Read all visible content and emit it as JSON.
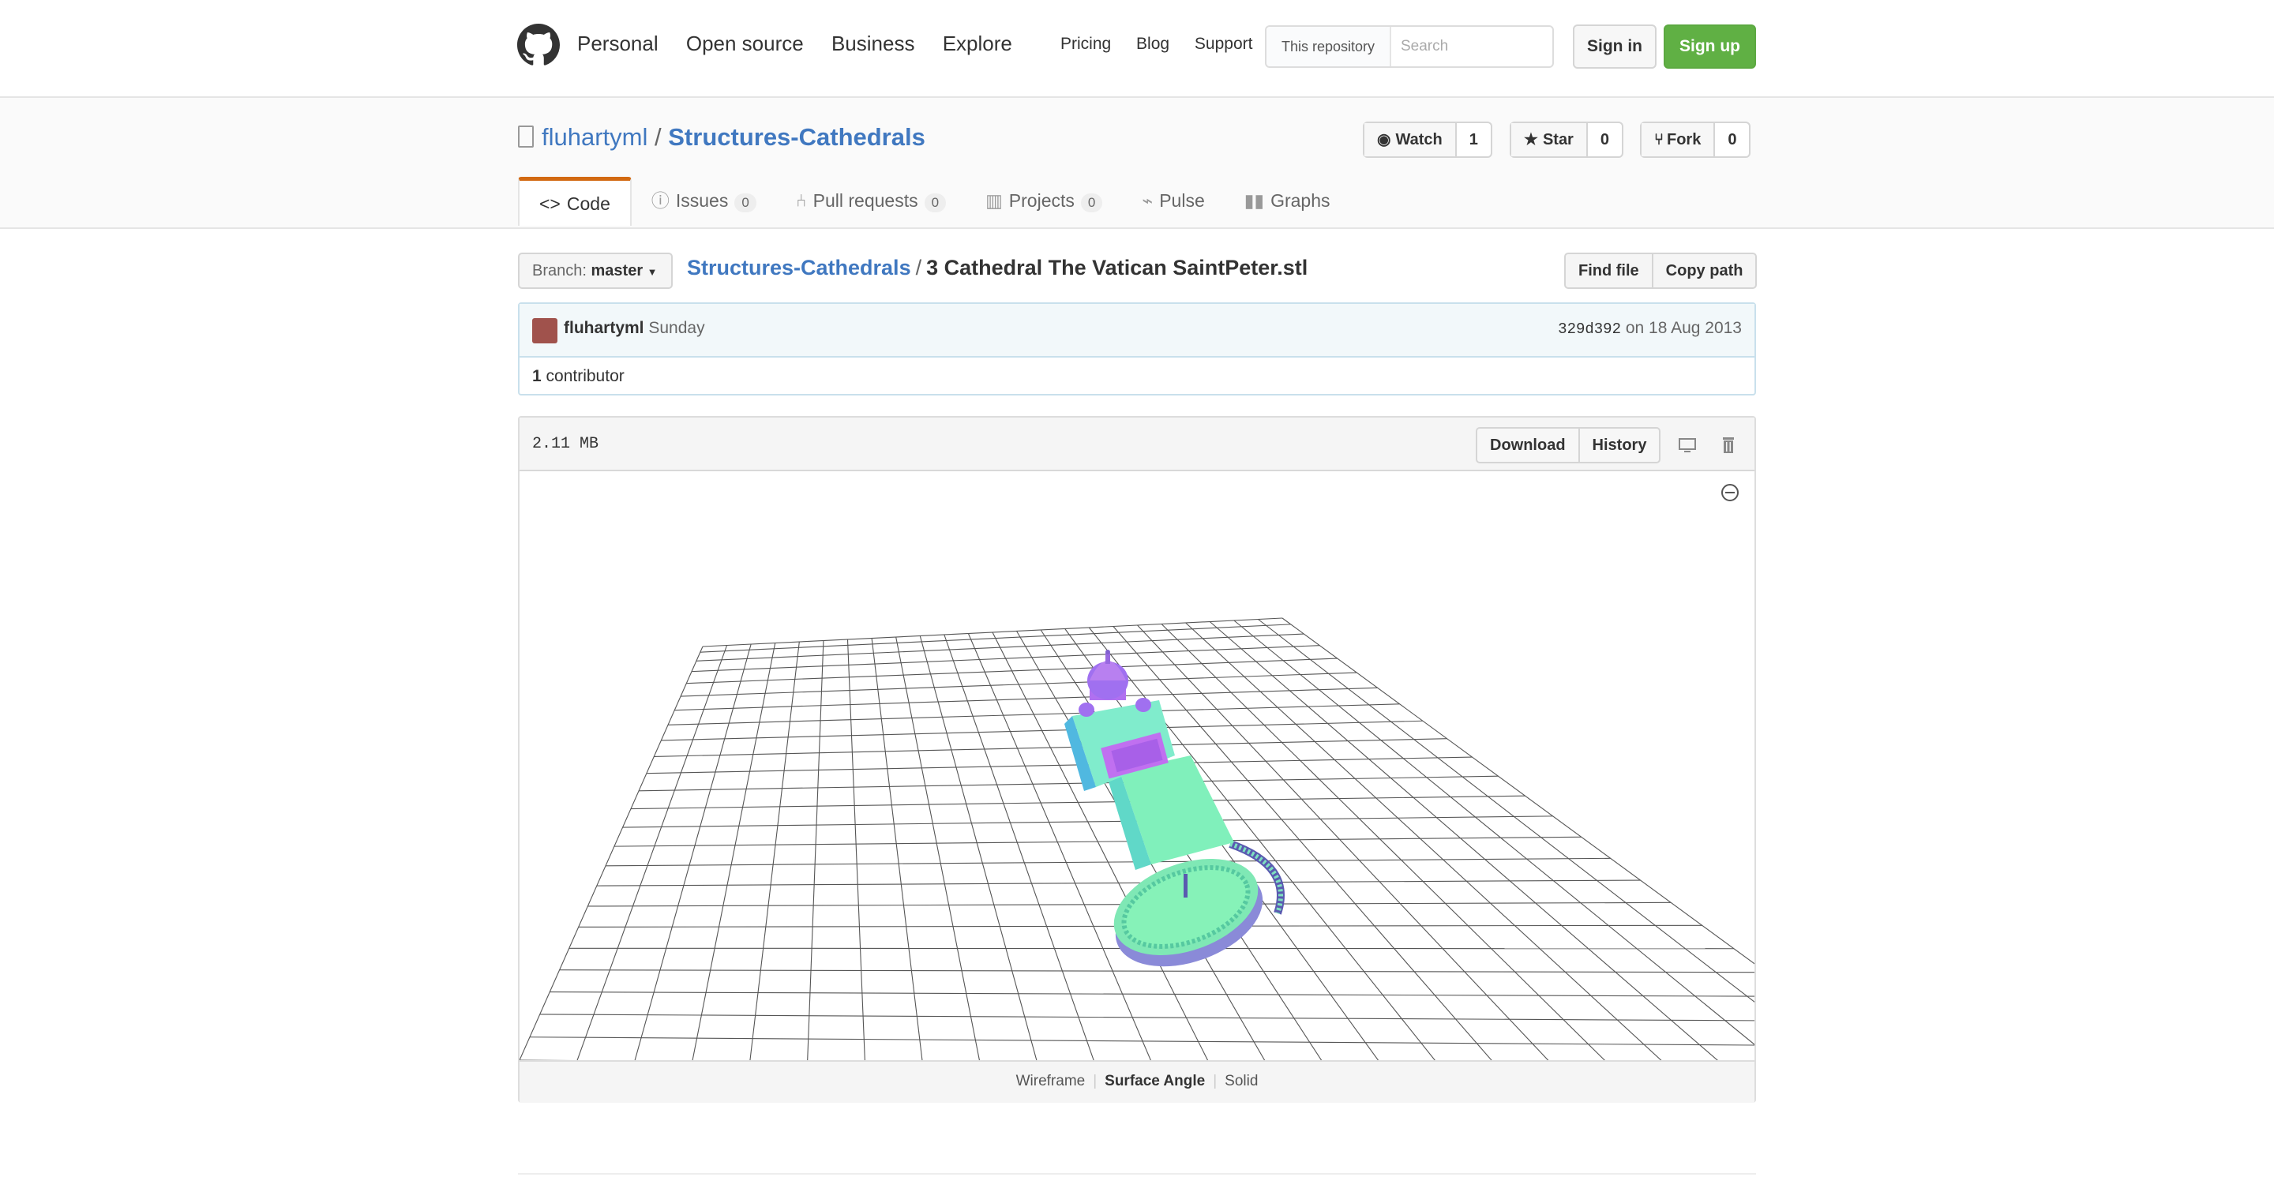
{
  "header": {
    "nav_main": [
      "Personal",
      "Open source",
      "Business",
      "Explore"
    ],
    "nav_sub": [
      "Pricing",
      "Blog",
      "Support"
    ],
    "search_scope": "This repository",
    "search_placeholder": "Search",
    "sign_in": "Sign in",
    "sign_up": "Sign up"
  },
  "repo": {
    "owner": "fluhartyml",
    "separator": "/",
    "name": "Structures-Cathedrals",
    "watch_label": "Watch",
    "watch_count": "1",
    "star_label": "Star",
    "star_count": "0",
    "fork_label": "Fork",
    "fork_count": "0",
    "tabs": [
      {
        "label": "Code",
        "icon": "code-icon",
        "count": ""
      },
      {
        "label": "Issues",
        "icon": "issue-icon",
        "count": "0"
      },
      {
        "label": "Pull requests",
        "icon": "pull-request-icon",
        "count": "0"
      },
      {
        "label": "Projects",
        "icon": "project-icon",
        "count": "0"
      },
      {
        "label": "Pulse",
        "icon": "pulse-icon",
        "count": ""
      },
      {
        "label": "Graphs",
        "icon": "graph-icon",
        "count": ""
      }
    ]
  },
  "file_nav": {
    "branch_label": "Branch:",
    "branch": "master",
    "breadcrumb_repo": "Structures-Cathedrals",
    "breadcrumb_sep": "/",
    "file_name": "3 Cathedral The Vatican SaintPeter.stl",
    "find_file": "Find file",
    "copy_path": "Copy path"
  },
  "commit": {
    "author": "fluhartyml",
    "when": "Sunday",
    "sha": "329d392",
    "date": "on 18 Aug 2013",
    "contributors_count": "1",
    "contributors_label": "contributor"
  },
  "file": {
    "size": "2.11 MB",
    "download": "Download",
    "history": "History",
    "view_modes": [
      "Wireframe",
      "Surface Angle",
      "Solid"
    ],
    "selected_mode": "Surface Angle"
  },
  "colors": {
    "link": "#4078c0",
    "signup_green": "#60b044",
    "tab_accent": "#d26911",
    "model_mint": "#7ff0b0",
    "model_purple": "#b070f0"
  }
}
